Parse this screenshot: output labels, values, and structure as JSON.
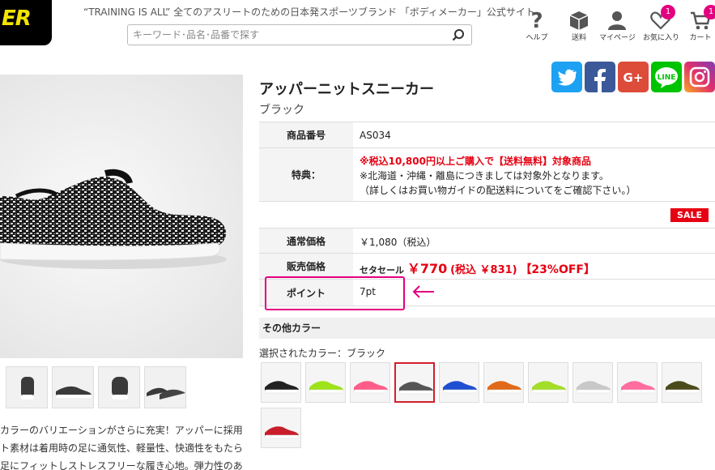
{
  "header": {
    "logo_text": "ER",
    "tagline": "“TRAINING IS ALL” 全てのアスリートのための日本発スポーツブランド 「ボディメーカー」公式サイト",
    "search_placeholder": "キーワード･品名･品番で探す",
    "nav": [
      {
        "label": "ヘルプ",
        "icon": "help-icon"
      },
      {
        "label": "送料",
        "icon": "shipping-box-icon"
      },
      {
        "label": "マイページ",
        "icon": "user-icon"
      },
      {
        "label": "お気に入り",
        "icon": "heart-icon",
        "badge": "1"
      },
      {
        "label": "カート",
        "icon": "cart-icon",
        "badge": "1"
      }
    ]
  },
  "social": [
    {
      "name": "twitter",
      "color": "#1da1f2"
    },
    {
      "name": "facebook",
      "color": "#3b5998"
    },
    {
      "name": "google-plus",
      "color": "#dd4b39",
      "text": "G+"
    },
    {
      "name": "line",
      "color": "#00c300",
      "text": "LINE"
    },
    {
      "name": "instagram",
      "color": "#c13584"
    }
  ],
  "product": {
    "title": "アッパーニットスニーカー",
    "color_name": "ブラック",
    "spec": {
      "code_label": "商品番号",
      "code_value": "AS034",
      "perk_label": "特典：",
      "perk_line1": "※税込10,800円以上ご購入で【送料無料】対象商品",
      "perk_line2": "※北海道・沖縄・離島につきましては対象外となります。",
      "perk_line3": "（詳しくはお買い物ガイドの配送料についてをご確認下さい。）",
      "sale_badge": "SALE",
      "regular_label": "通常価格",
      "regular_value": "￥1,080（税込）",
      "price_label": "販売価格",
      "price_prefix": "セタセール",
      "price_main": "￥770",
      "price_tax": "(税込 ￥831)",
      "price_off": "【23%OFF】",
      "point_label": "ポイント",
      "point_value": "7pt"
    },
    "arrow": "←",
    "other_colors_heading": "その他カラー",
    "selected_color_text": "選択されたカラー：ブラック",
    "swatches": [
      {
        "name": "black-white",
        "color": "#222222"
      },
      {
        "name": "lime",
        "color": "#9ee21a"
      },
      {
        "name": "pink",
        "color": "#ff5c8a"
      },
      {
        "name": "black-knit",
        "color": "#555555",
        "selected": true
      },
      {
        "name": "blue",
        "color": "#1f4fd1"
      },
      {
        "name": "orange",
        "color": "#e06a1a"
      },
      {
        "name": "lime-knit",
        "color": "#a4dd2a"
      },
      {
        "name": "grey",
        "color": "#c8c8c8"
      },
      {
        "name": "pink-knit",
        "color": "#ff6d9f"
      },
      {
        "name": "olive",
        "color": "#4b4a1a"
      },
      {
        "name": "red",
        "color": "#c81d2a"
      }
    ],
    "description": [
      "カラーのバリエーションがさらに充実！アッパーに採用",
      "ト素材は着用時の足に通気性、軽量性、快適性をもたら",
      "足にフィットしストレスフリーな履き心地。弾力性のあ"
    ]
  },
  "colors": {
    "accent_red": "#e60012",
    "highlight_pink": "#e4007f"
  }
}
